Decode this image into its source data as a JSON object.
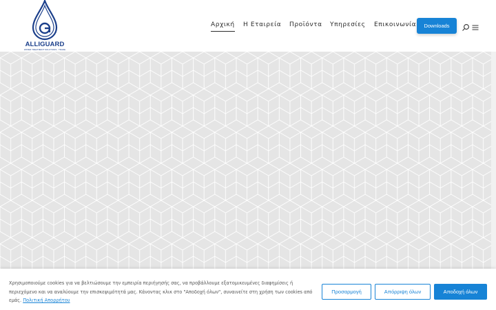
{
  "header": {
    "logo": {
      "word": "ALLIGUARD",
      "tagline": "WATER TREATMENT SOLUTIONS · TRADE"
    },
    "nav": [
      {
        "label": "Αρχική",
        "active": true
      },
      {
        "label": "Η Εταιρεία",
        "active": false
      },
      {
        "label": "Προϊόντα",
        "active": false
      },
      {
        "label": "Υπηρεσίες",
        "active": false
      },
      {
        "label": "Επικοινωνία",
        "active": false
      }
    ],
    "downloads_label": "Downloads",
    "icons": [
      "search-icon",
      "hamburger-menu-icon"
    ]
  },
  "hero": {
    "pattern": "isometric-cube-outline",
    "background_color": "#e5e5e5",
    "line_color": "#ffffff"
  },
  "cookie_banner": {
    "text": "Χρησιμοποιούμε cookies για να βελτιώσουμε την εμπειρία περιήγησής σας, να προβάλλουμε εξατομικευμένες διαφημίσεις ή περιεχόμενο και να αναλύουμε την επισκεψιμότητά μας. Κάνοντας κλικ στο \"Αποδοχή όλων\", συναινείτε στη χρήση των cookies από εμάς.",
    "policy_link": "Πολιτική Απορρήτου",
    "buttons": {
      "customize": "Προσαρμογή",
      "reject": "Απόρριψη όλων",
      "accept": "Αποδοχή όλων"
    }
  },
  "colors": {
    "accent": "#1783d6",
    "brand_dark": "#1b3f8b",
    "text": "#2b2b2b"
  }
}
